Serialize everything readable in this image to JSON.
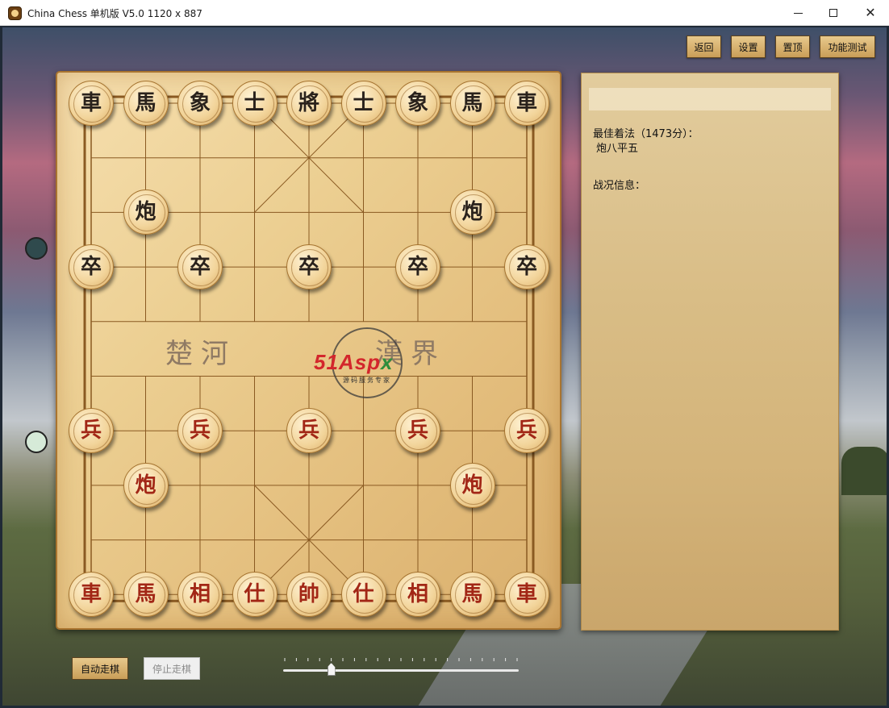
{
  "window": {
    "title": "China Chess 单机版 V5.0  1120 x 887",
    "icon": "chess-app-icon"
  },
  "toolbar": {
    "buttons": [
      {
        "name": "back-button",
        "label": "返回"
      },
      {
        "name": "settings-button",
        "label": "设置"
      },
      {
        "name": "pin-top-button",
        "label": "置顶"
      },
      {
        "name": "feature-test-button",
        "label": "功能测试"
      }
    ]
  },
  "board": {
    "river_left": "楚河",
    "river_right": "漢界",
    "watermark_main": "51Aspx",
    "watermark_sub": "源码服务专家",
    "columns": 9,
    "rows": 10,
    "pieces": [
      {
        "char": "車",
        "side": "black",
        "col": 0,
        "row": 0
      },
      {
        "char": "馬",
        "side": "black",
        "col": 1,
        "row": 0
      },
      {
        "char": "象",
        "side": "black",
        "col": 2,
        "row": 0
      },
      {
        "char": "士",
        "side": "black",
        "col": 3,
        "row": 0
      },
      {
        "char": "將",
        "side": "black",
        "col": 4,
        "row": 0
      },
      {
        "char": "士",
        "side": "black",
        "col": 5,
        "row": 0
      },
      {
        "char": "象",
        "side": "black",
        "col": 6,
        "row": 0
      },
      {
        "char": "馬",
        "side": "black",
        "col": 7,
        "row": 0
      },
      {
        "char": "車",
        "side": "black",
        "col": 8,
        "row": 0
      },
      {
        "char": "炮",
        "side": "black",
        "col": 1,
        "row": 2
      },
      {
        "char": "炮",
        "side": "black",
        "col": 7,
        "row": 2
      },
      {
        "char": "卒",
        "side": "black",
        "col": 0,
        "row": 3
      },
      {
        "char": "卒",
        "side": "black",
        "col": 2,
        "row": 3
      },
      {
        "char": "卒",
        "side": "black",
        "col": 4,
        "row": 3
      },
      {
        "char": "卒",
        "side": "black",
        "col": 6,
        "row": 3
      },
      {
        "char": "卒",
        "side": "black",
        "col": 8,
        "row": 3
      },
      {
        "char": "兵",
        "side": "red",
        "col": 0,
        "row": 6
      },
      {
        "char": "兵",
        "side": "red",
        "col": 2,
        "row": 6
      },
      {
        "char": "兵",
        "side": "red",
        "col": 4,
        "row": 6
      },
      {
        "char": "兵",
        "side": "red",
        "col": 6,
        "row": 6
      },
      {
        "char": "兵",
        "side": "red",
        "col": 8,
        "row": 6
      },
      {
        "char": "炮",
        "side": "red",
        "col": 1,
        "row": 7
      },
      {
        "char": "炮",
        "side": "red",
        "col": 7,
        "row": 7
      },
      {
        "char": "車",
        "side": "red",
        "col": 0,
        "row": 9
      },
      {
        "char": "馬",
        "side": "red",
        "col": 1,
        "row": 9
      },
      {
        "char": "相",
        "side": "red",
        "col": 2,
        "row": 9
      },
      {
        "char": "仕",
        "side": "red",
        "col": 3,
        "row": 9
      },
      {
        "char": "帥",
        "side": "red",
        "col": 4,
        "row": 9
      },
      {
        "char": "仕",
        "side": "red",
        "col": 5,
        "row": 9
      },
      {
        "char": "相",
        "side": "red",
        "col": 6,
        "row": 9
      },
      {
        "char": "馬",
        "side": "red",
        "col": 7,
        "row": 9
      },
      {
        "char": "車",
        "side": "red",
        "col": 8,
        "row": 9
      }
    ]
  },
  "info_panel": {
    "best_move_label": "最佳着法（1473分）：",
    "best_move_value": "炮八平五",
    "battle_info_label": "战况信息："
  },
  "controls": {
    "auto_play_label": "自动走棋",
    "stop_play_label": "停止走棋",
    "speed_slider": {
      "min": 0,
      "max": 20,
      "value": 4
    }
  },
  "colors": {
    "black_piece_text": "#2a221c",
    "red_piece_text": "#a22716",
    "board_line": "#8a5a22"
  }
}
